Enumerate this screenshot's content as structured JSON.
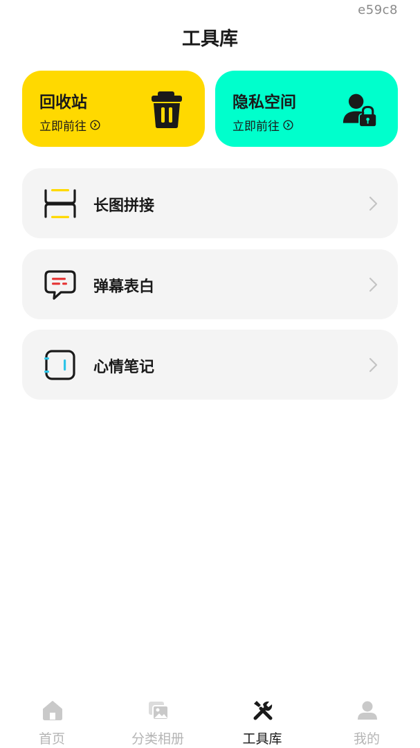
{
  "corner_code": "e59c8",
  "page_title": "工具库",
  "top_cards": [
    {
      "title": "回收站",
      "link": "立即前往",
      "icon": "trash-icon",
      "color": "#FFD900"
    },
    {
      "title": "隐私空间",
      "link": "立即前往",
      "icon": "user-lock-icon",
      "color": "#00FFCC"
    }
  ],
  "tools": [
    {
      "label": "长图拼接",
      "icon": "long-image-stitch-icon"
    },
    {
      "label": "弹幕表白",
      "icon": "chat-bubble-icon"
    },
    {
      "label": "心情笔记",
      "icon": "note-icon"
    }
  ],
  "tabbar": {
    "items": [
      {
        "label": "首页",
        "icon": "home-icon",
        "active": false
      },
      {
        "label": "分类相册",
        "icon": "album-icon",
        "active": false
      },
      {
        "label": "工具库",
        "icon": "tools-icon",
        "active": true
      },
      {
        "label": "我的",
        "icon": "profile-icon",
        "active": false
      }
    ]
  },
  "colors": {
    "accent_yellow": "#FFD900",
    "accent_cyan": "#00FFCC",
    "row_background": "#F4F4F4",
    "tab_inactive": "#B5B5B5"
  }
}
